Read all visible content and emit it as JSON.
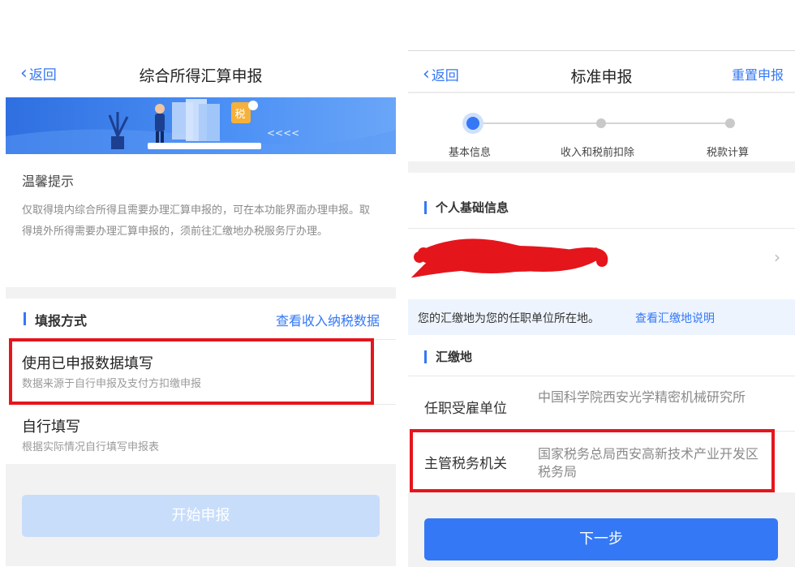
{
  "left": {
    "nav": {
      "back_label": "返回",
      "title": "综合所得汇算申报"
    },
    "banner": {
      "tax_char": "税",
      "arrows": "<<<<"
    },
    "tips": {
      "title": "温馨提示",
      "body": "仅取得境内综合所得且需要办理汇算申报的，可在本功能界面办理申报。取得境外所得需要办理汇算申报的，须前往汇缴地办税服务厅办理。"
    },
    "section": {
      "title": "填报方式",
      "link": "查看收入纳税数据"
    },
    "options": [
      {
        "title": "使用已申报数据填写",
        "desc": "数据来源于自行申报及支付方扣缴申报"
      },
      {
        "title": "自行填写",
        "desc": "根据实际情况自行填写申报表"
      }
    ],
    "start_button": "开始申报"
  },
  "right": {
    "nav": {
      "back_label": "返回",
      "title": "标准申报",
      "reset_label": "重置申报"
    },
    "steps": [
      "基本信息",
      "收入和税前扣除",
      "税款计算"
    ],
    "personal_section": "个人基础信息",
    "personal_row_arrow": "›",
    "notice": {
      "text": "您的汇缴地为您的任职单位所在地。",
      "link": "查看汇缴地说明"
    },
    "remit_section": "汇缴地",
    "rows": [
      {
        "label": "任职受雇单位",
        "value": "中国科学院西安光学精密机械研究所"
      },
      {
        "label": "主管税务机关",
        "value": "国家税务总局西安高新技术产业开发区税务局"
      }
    ],
    "next_button": "下一步"
  },
  "colors": {
    "accent": "#3478f6",
    "highlight_box": "#e5151c",
    "disabled_button": "#c8ddfa",
    "redaction": "#e5151c"
  }
}
